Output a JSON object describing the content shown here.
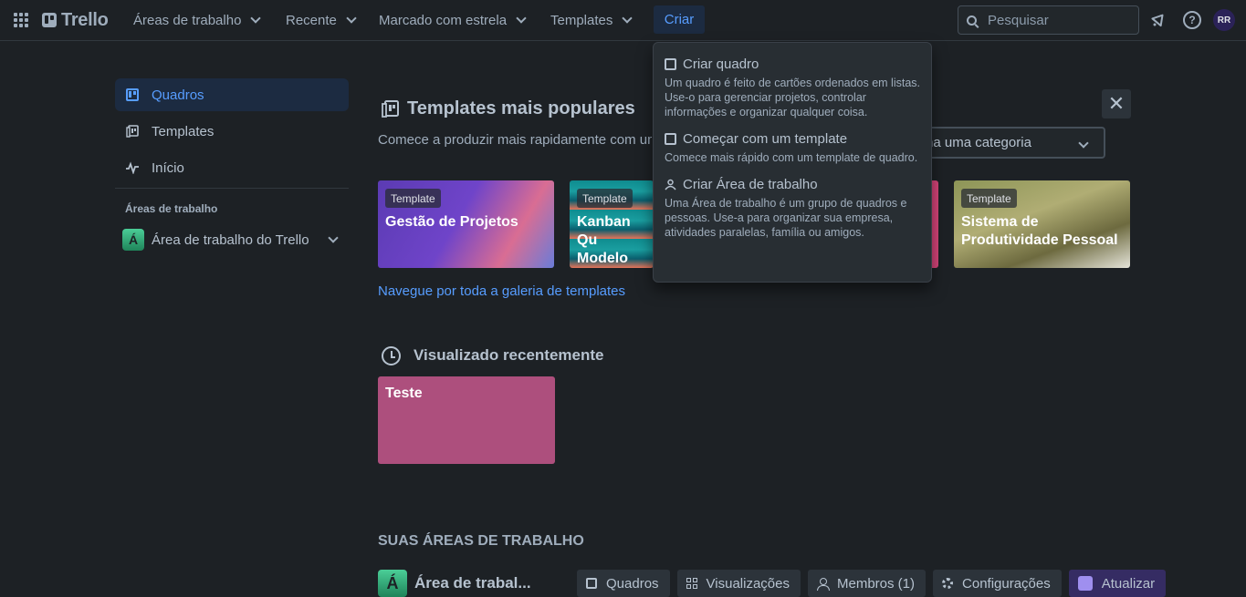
{
  "topbar": {
    "logo_text": "Trello",
    "nav": [
      {
        "label": "Áreas de trabalho"
      },
      {
        "label": "Recente"
      },
      {
        "label": "Marcado com estrela"
      },
      {
        "label": "Templates"
      }
    ],
    "create_label": "Criar",
    "search_placeholder": "Pesquisar",
    "avatar_initials": "RR",
    "help_glyph": "?"
  },
  "sidebar": {
    "items": [
      {
        "label": "Quadros",
        "icon": "board-icon",
        "active": true
      },
      {
        "label": "Templates",
        "icon": "template-icon"
      },
      {
        "label": "Início",
        "icon": "activity-icon"
      }
    ],
    "workspaces_heading": "Áreas de trabalho",
    "workspace": {
      "badge": "Á",
      "name": "Área de trabalho do Trello"
    }
  },
  "templates_section": {
    "title": "Templates mais populares",
    "subtitle": "Comece a produzir mais rapidamente com um",
    "category_placeholder": "na uma categoria",
    "cards": [
      {
        "badge": "Template",
        "title": "Gestão de Projetos"
      },
      {
        "badge": "Template",
        "title": "Kanban Qu Modelo"
      },
      {
        "badge": "",
        "title": ""
      },
      {
        "badge": "Template",
        "title": "Sistema de Produtividade Pessoal"
      }
    ],
    "gallery_link": "Navegue por toda a galeria de templates"
  },
  "recent": {
    "title": "Visualizado recentemente",
    "boards": [
      {
        "title": "Teste",
        "color": "#ad4f7d"
      }
    ]
  },
  "workspaces_section": {
    "title": "SUAS ÁREAS DE TRABALHO",
    "workspace_badge": "Á",
    "workspace_name": "Área de trabal...",
    "buttons": [
      {
        "label": "Quadros",
        "icon": "board-icon"
      },
      {
        "label": "Visualizações",
        "icon": "grid-icon"
      },
      {
        "label": "Membros (1)",
        "icon": "user-icon"
      },
      {
        "label": "Configurações",
        "icon": "gear-icon"
      },
      {
        "label": "Atualizar",
        "icon": "upgrade-icon"
      }
    ]
  },
  "create_menu": {
    "items": [
      {
        "title": "Criar quadro",
        "desc": "Um quadro é feito de cartões ordenados em listas. Use-o para gerenciar projetos, controlar informações e organizar qualquer coisa."
      },
      {
        "title": "Começar com um template",
        "desc": "Comece mais rápido com um template de quadro."
      },
      {
        "title": "Criar Área de trabalho",
        "desc": "Uma Área de trabalho é um grupo de quadros e pessoas. Use-a para organizar sua empresa, atividades paralelas, família ou amigos."
      }
    ]
  },
  "colors": {
    "accent": "#579dff",
    "background": "#1d2125",
    "active_bg": "#1c2b41"
  }
}
